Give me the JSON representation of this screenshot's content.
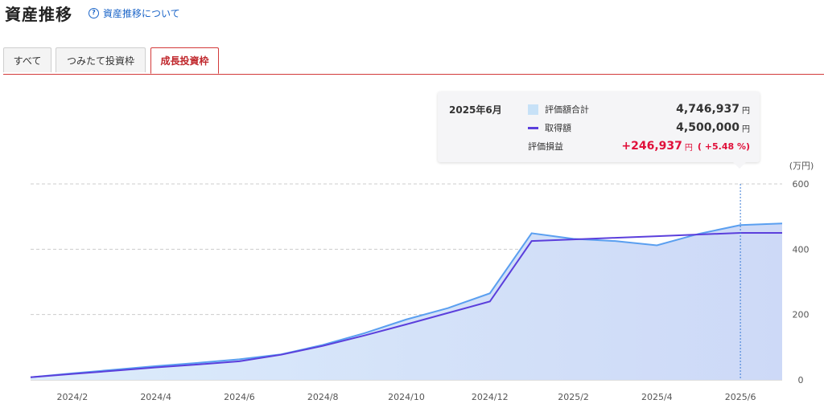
{
  "header": {
    "title": "資産推移",
    "help_icon": "question-circle-icon",
    "help_link": "資産推移について"
  },
  "tabs": [
    {
      "label": "すべて",
      "active": false
    },
    {
      "label": "つみたて投資枠",
      "active": false
    },
    {
      "label": "成長投資枠",
      "active": true
    }
  ],
  "tooltip": {
    "date": "2025年6月",
    "valuation_label": "評価額合計",
    "valuation_value": "4,746,937",
    "cost_label": "取得額",
    "cost_value": "4,500,000",
    "pl_label": "評価損益",
    "pl_value": "+246,937",
    "pl_pct": "( +5.48 %)",
    "unit": "円"
  },
  "colors": {
    "accent_red": "#d33a3a",
    "area_line": "#5a9ff0",
    "cost_line": "#5b3fdc",
    "profit": "#e0103a"
  },
  "chart_data": {
    "type": "area",
    "y_unit_label": "(万円)",
    "ylim": [
      0,
      600
    ],
    "y_ticks": [
      0,
      200,
      400,
      600
    ],
    "x_tick_labels": [
      "2024/2",
      "2024/4",
      "2024/6",
      "2024/8",
      "2024/10",
      "2024/12",
      "2025/2",
      "2025/4",
      "2025/6"
    ],
    "x": [
      "2024/1",
      "2024/2",
      "2024/3",
      "2024/4",
      "2024/5",
      "2024/6",
      "2024/7",
      "2024/8",
      "2024/9",
      "2024/10",
      "2024/11",
      "2024/12",
      "2025/1",
      "2025/2",
      "2025/3",
      "2025/4",
      "2025/5",
      "2025/6",
      "2025/7"
    ],
    "series": [
      {
        "name": "評価額合計",
        "values": [
          8,
          20,
          31,
          42,
          52,
          63,
          78,
          107,
          143,
          185,
          220,
          265,
          449,
          432,
          425,
          412,
          447,
          474,
          479
        ]
      },
      {
        "name": "取得額",
        "values": [
          8,
          18,
          28,
          38,
          47,
          57,
          77,
          104,
          136,
          170,
          205,
          240,
          425,
          430,
          435,
          440,
          445,
          450,
          450
        ]
      }
    ],
    "highlight_x": "2025/6",
    "grid": true
  }
}
